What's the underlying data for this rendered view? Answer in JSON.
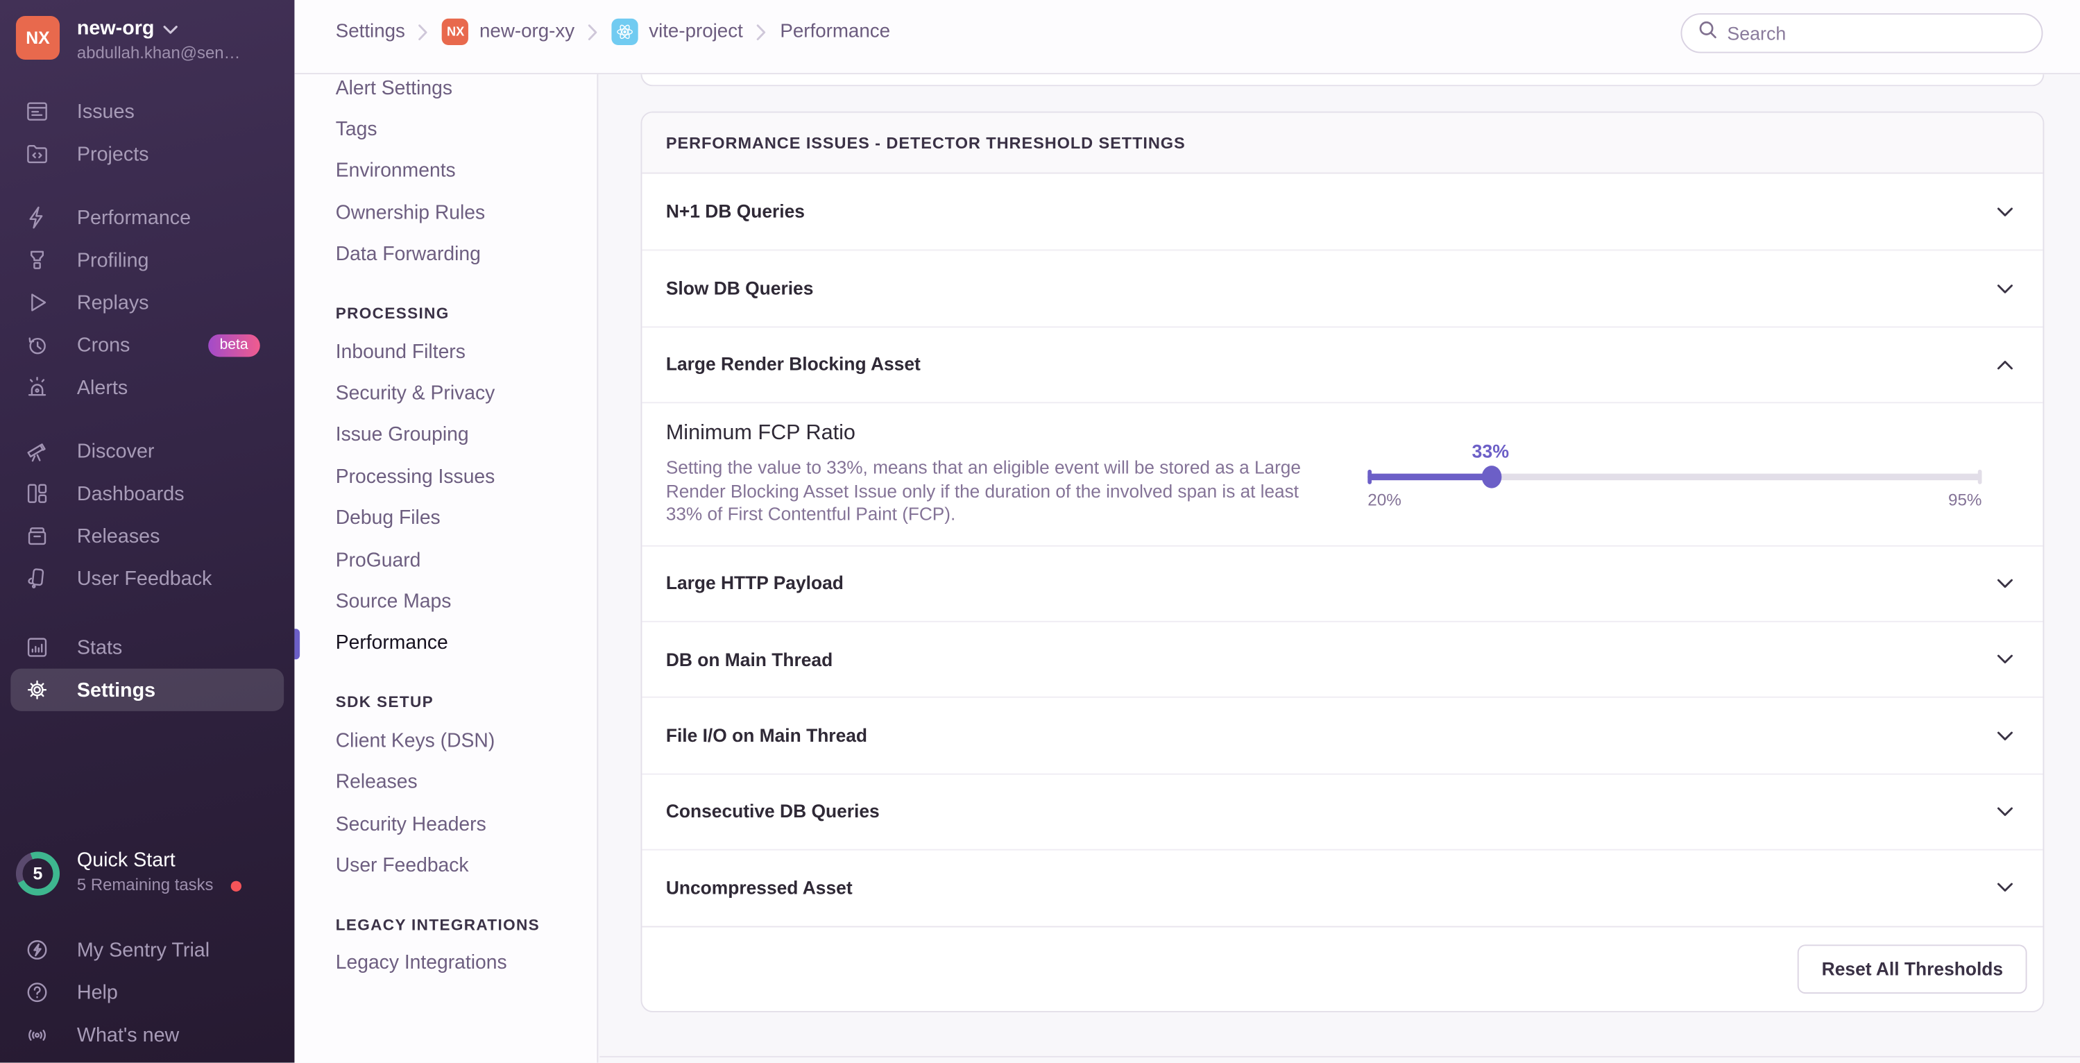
{
  "colors": {
    "accent_purple": "#6C5FC7",
    "org_avatar_orange": "#E8694D",
    "react_badge_blue": "#71CBF1",
    "beta_gradient_start": "#A24BC9",
    "beta_gradient_end": "#F05C8E",
    "progress_green": "#3EB78F",
    "notification_red": "#F55459"
  },
  "sidebar": {
    "org": {
      "avatar_text": "NX",
      "name": "new-org",
      "email": "abdullah.khan@sen…"
    },
    "groups": [
      {
        "items": [
          {
            "label": "Issues",
            "icon": "issues-icon"
          },
          {
            "label": "Projects",
            "icon": "projects-icon"
          }
        ]
      },
      {
        "items": [
          {
            "label": "Performance",
            "icon": "lightning-icon"
          },
          {
            "label": "Profiling",
            "icon": "profiling-icon"
          },
          {
            "label": "Replays",
            "icon": "play-icon"
          },
          {
            "label": "Crons",
            "icon": "clock-history-icon",
            "badge": "beta"
          },
          {
            "label": "Alerts",
            "icon": "siren-icon"
          }
        ]
      },
      {
        "items": [
          {
            "label": "Discover",
            "icon": "telescope-icon"
          },
          {
            "label": "Dashboards",
            "icon": "dashboards-icon"
          },
          {
            "label": "Releases",
            "icon": "archive-box-icon"
          },
          {
            "label": "User Feedback",
            "icon": "feedback-icon"
          }
        ]
      },
      {
        "items": [
          {
            "label": "Stats",
            "icon": "bar-chart-icon"
          },
          {
            "label": "Settings",
            "icon": "gear-icon",
            "active": true
          }
        ]
      }
    ],
    "quick_start": {
      "count": "5",
      "title": "Quick Start",
      "subtitle": "5 Remaining tasks"
    },
    "footer_items": [
      {
        "label": "My Sentry Trial",
        "icon": "bolt-circle-icon"
      },
      {
        "label": "Help",
        "icon": "question-circle-icon"
      },
      {
        "label": "What's new",
        "icon": "broadcast-icon"
      }
    ]
  },
  "header": {
    "breadcrumbs": [
      {
        "label": "Settings"
      },
      {
        "label": "new-org-xy",
        "badge_text": "NX"
      },
      {
        "label": "vite-project",
        "badge_icon": "react-logo-icon"
      },
      {
        "label": "Performance"
      }
    ],
    "search_placeholder": "Search"
  },
  "settings_nav": {
    "groups": [
      {
        "items": [
          "Alert Settings",
          "Tags",
          "Environments",
          "Ownership Rules",
          "Data Forwarding"
        ]
      },
      {
        "header": "PROCESSING",
        "items": [
          "Inbound Filters",
          "Security & Privacy",
          "Issue Grouping",
          "Processing Issues",
          "Debug Files",
          "ProGuard",
          "Source Maps",
          "Performance"
        ],
        "active_item": "Performance"
      },
      {
        "header": "SDK SETUP",
        "items": [
          "Client Keys (DSN)",
          "Releases",
          "Security Headers",
          "User Feedback"
        ]
      },
      {
        "header": "LEGACY INTEGRATIONS",
        "items": [
          "Legacy Integrations"
        ]
      }
    ]
  },
  "panel": {
    "title": "PERFORMANCE ISSUES - DETECTOR THRESHOLD SETTINGS",
    "rows_before": [
      "N+1 DB Queries",
      "Slow DB Queries"
    ],
    "expanded_row": "Large Render Blocking Asset",
    "rows_after": [
      "Large HTTP Payload",
      "DB on Main Thread",
      "File I/O on Main Thread",
      "Consecutive DB Queries",
      "Uncompressed Asset"
    ],
    "expanded": {
      "heading": "Minimum FCP Ratio",
      "description": "Setting the value to 33%, means that an eligible event will be stored as a Large Render Blocking Asset Issue only if the duration of the involved span is at least 33% of First Contentful Paint (FCP).",
      "slider": {
        "value": 33,
        "min": 20,
        "max": 95,
        "value_label": "33%",
        "min_label": "20%",
        "max_label": "95%"
      }
    },
    "footer_button": "Reset All Thresholds"
  }
}
